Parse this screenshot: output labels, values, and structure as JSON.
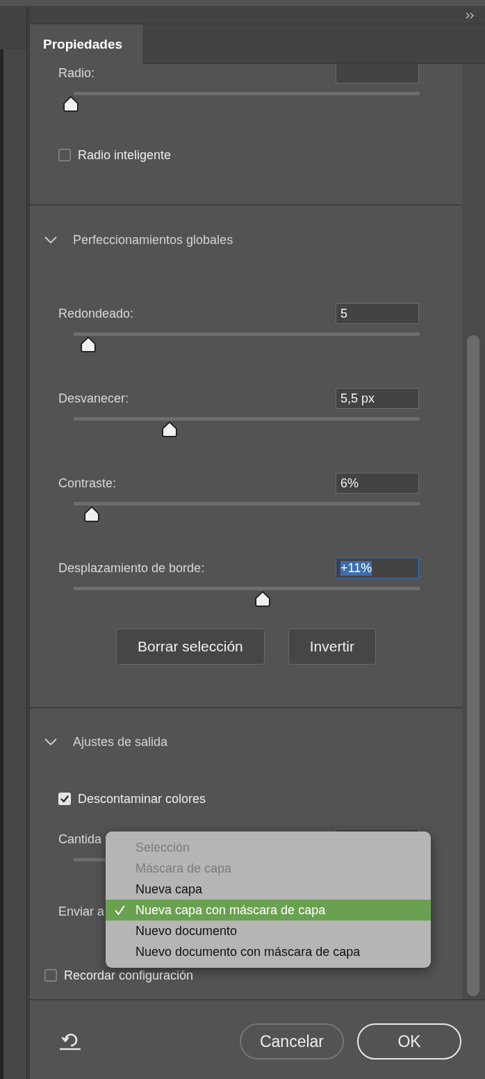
{
  "tabs": [
    {
      "label": "Propiedades",
      "selected": true
    }
  ],
  "sections": [
    {
      "controls": [
        {
          "kind": "slider",
          "label": "Radio:",
          "level": 0,
          "focused": false
        },
        {
          "kind": "checkbox",
          "label": "Radio inteligente",
          "checked": false
        }
      ]
    },
    {
      "title": "Perfeccionamientos globales",
      "expanded": true,
      "controls": [
        {
          "kind": "slider",
          "label": "Redondeado:",
          "value": "5",
          "level": 0.05,
          "focused": false
        },
        {
          "kind": "slider",
          "label": "Desvanecer:",
          "value": "5,5 px",
          "level": 0.285,
          "focused": false
        },
        {
          "kind": "slider",
          "label": "Contraste:",
          "value": "6%",
          "level": 0.06,
          "focused": false
        },
        {
          "kind": "slider",
          "label": "Desplazamiento de borde:",
          "value": "+11%",
          "level": 0.555,
          "focused": true
        }
      ],
      "buttons": [
        {
          "label": "Borrar selección"
        },
        {
          "label": "Invertir"
        }
      ]
    },
    {
      "title": "Ajustes de salida",
      "expanded": true,
      "controls": [
        {
          "kind": "checkbox",
          "label": "Descontaminar colores",
          "checked": true
        },
        {
          "kind": "slider",
          "label": "Cantida",
          "focused": false
        },
        {
          "kind": "select",
          "label": "Enviar a",
          "open": true,
          "menu": [
            {
              "label": "Selección",
              "disabled": true,
              "selected": false
            },
            {
              "label": "Máscara de capa",
              "disabled": true,
              "selected": false
            },
            {
              "label": "Nueva capa",
              "disabled": false,
              "selected": false
            },
            {
              "label": "Nueva capa con máscara de capa",
              "disabled": false,
              "selected": true
            },
            {
              "label": "Nuevo documento",
              "disabled": false,
              "selected": false
            },
            {
              "label": "Nuevo documento con máscara de capa",
              "disabled": false,
              "selected": false
            }
          ]
        }
      ]
    }
  ],
  "remember": {
    "label": "Recordar configuración",
    "checked": false
  },
  "footer": {
    "buttons": [
      {
        "label": "Cancelar",
        "kind": "secondary"
      },
      {
        "label": "OK",
        "kind": "primary"
      }
    ]
  }
}
